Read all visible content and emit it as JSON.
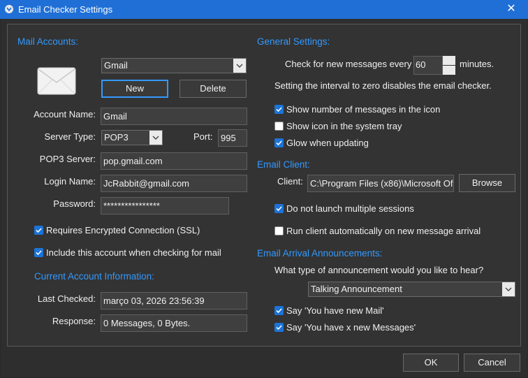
{
  "window": {
    "title": "Email Checker Settings",
    "close_glyph": "✕"
  },
  "mail_accounts": {
    "heading": "Mail Accounts:",
    "account_select": "Gmail",
    "new_label": "New",
    "delete_label": "Delete",
    "account_name_label": "Account Name:",
    "account_name": "Gmail",
    "server_type_label": "Server Type:",
    "server_type": "POP3",
    "port_label": "Port:",
    "port": "995",
    "pop3_server_label": "POP3 Server:",
    "pop3_server": "pop.gmail.com",
    "login_name_label": "Login Name:",
    "login_name": "JcRabbit@gmail.com",
    "password_label": "Password:",
    "password": "****************",
    "ssl_label": "Requires Encrypted Connection (SSL)",
    "ssl_checked": true,
    "include_label": "Include this account when checking for mail",
    "include_checked": true
  },
  "current_account": {
    "heading": "Current Account Information:",
    "last_checked_label": "Last Checked:",
    "last_checked": "março 03, 2026 23:56:39",
    "response_label": "Response:",
    "response": "0 Messages, 0 Bytes."
  },
  "general": {
    "heading": "General Settings:",
    "check_prefix": "Check for new messages every",
    "interval": "60",
    "check_suffix": "minutes.",
    "interval_note": "Setting the interval to zero disables the email checker.",
    "show_count_label": "Show number of messages in the icon",
    "show_count_checked": true,
    "show_tray_label": "Show icon in the system tray",
    "show_tray_checked": false,
    "glow_label": "Glow when updating",
    "glow_checked": true
  },
  "email_client": {
    "heading": "Email Client:",
    "client_label": "Client:",
    "client_path": "C:\\Program Files (x86)\\Microsoft Of",
    "browse_label": "Browse",
    "no_multiple_label": "Do not launch multiple sessions",
    "no_multiple_checked": true,
    "auto_run_label": "Run client automatically on new message arrival",
    "auto_run_checked": false
  },
  "announcements": {
    "heading": "Email Arrival Announcements:",
    "question": "What type of announcement would you like to hear?",
    "type": "Talking Announcement",
    "say_new_mail_label": "Say 'You have new Mail'",
    "say_new_mail_checked": true,
    "say_x_label": "Say 'You have x new Messages'",
    "say_x_checked": true
  },
  "footer": {
    "ok_label": "OK",
    "cancel_label": "Cancel"
  },
  "icons": [
    "app-icon",
    "close-icon",
    "envelope-icon",
    "chevron-down-icon",
    "checkmark-icon",
    "spin-up-icon",
    "spin-down-icon"
  ],
  "colors": {
    "titlebar": "#1f6fd6",
    "section_heading": "#3399ff",
    "checkbox": "#1c74d8",
    "background": "#333333"
  }
}
